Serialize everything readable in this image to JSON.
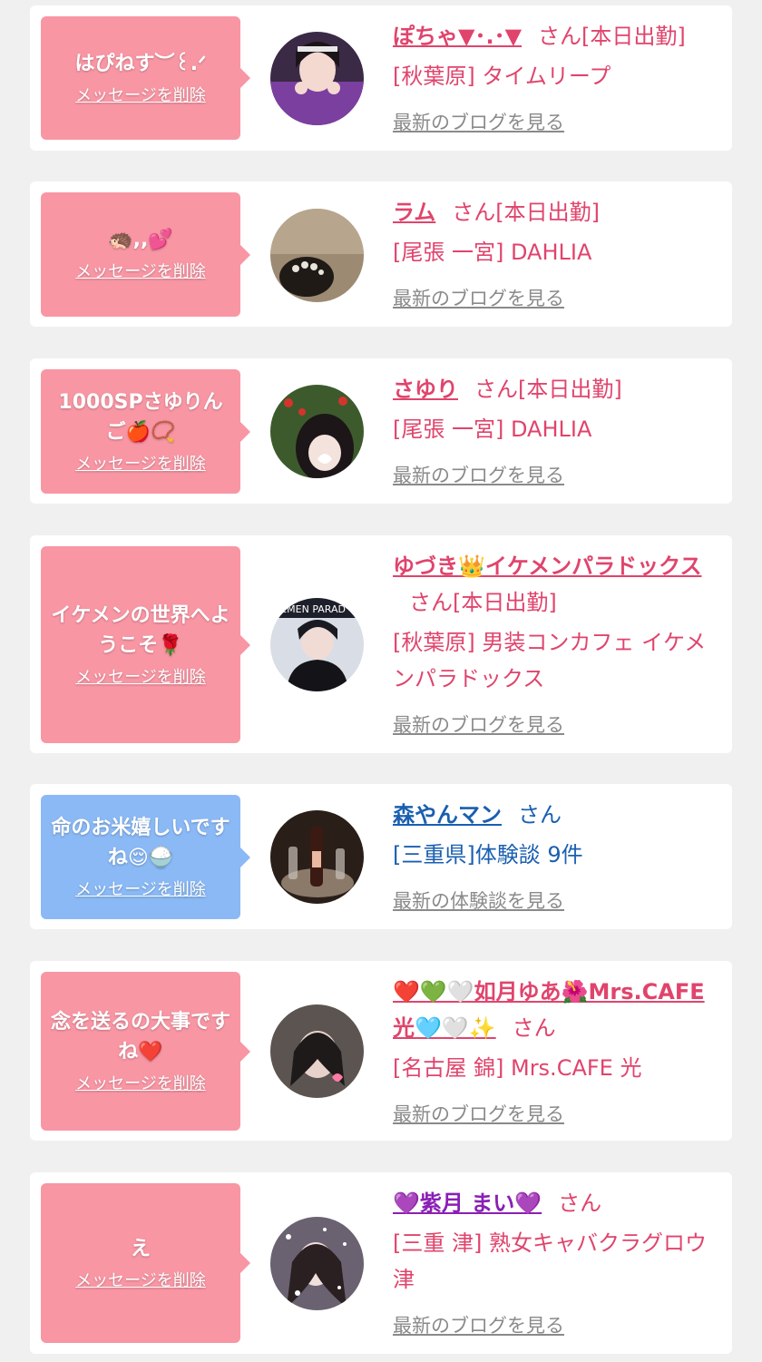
{
  "delete_label": "メッセージを削除",
  "san_label": "さん",
  "colors": {
    "pink_bubble": "#f896a4",
    "blue_bubble": "#8ab9f5",
    "pink_text": "#e0446c",
    "blue_text": "#1a5fb0",
    "link_gray": "#8a8a8a"
  },
  "cards": [
    {
      "message": "はぴねす︶꒰.ᐟ",
      "name": "ぽちゃ▼･.･▼",
      "status": "[本日出勤]",
      "place": "[秋葉原] タイムリープ",
      "link": "最新のブログを見る"
    },
    {
      "message": "🦔,,💕",
      "name": "ラム",
      "status": "[本日出勤]",
      "place": "[尾張 一宮] DAHLIA",
      "link": "最新のブログを見る"
    },
    {
      "message": "1000SPさゆりんご🍎📿",
      "name": "さゆり",
      "status": "[本日出勤]",
      "place": "[尾張 一宮] DAHLIA",
      "link": "最新のブログを見る"
    },
    {
      "message": "イケメンの世界へようこそ🌹",
      "name": "ゆづき👑イケメンパラドックス",
      "status": "[本日出勤]",
      "place": "[秋葉原] 男装コンカフェ イケメンパラドックス",
      "link": "最新のブログを見る"
    },
    {
      "message": "命のお米嬉しいですね😌🍚",
      "name": "森やんマン",
      "status": "",
      "place": "[三重県]体験談 9件",
      "link": "最新の体験談を見る"
    },
    {
      "message": "念を送るの大事ですね❤️",
      "name": "❤️💚🤍如月ゆあ🌺Mrs.CAFE光🩵🤍✨",
      "status": "",
      "place": "[名古屋 錦] Mrs.CAFE 光",
      "link": "最新のブログを見る"
    },
    {
      "message": "え",
      "name": "💜紫月 まい💜",
      "status": "",
      "place": "[三重 津] 熟女キャバクラグロウ津",
      "link": "最新のブログを見る"
    }
  ]
}
